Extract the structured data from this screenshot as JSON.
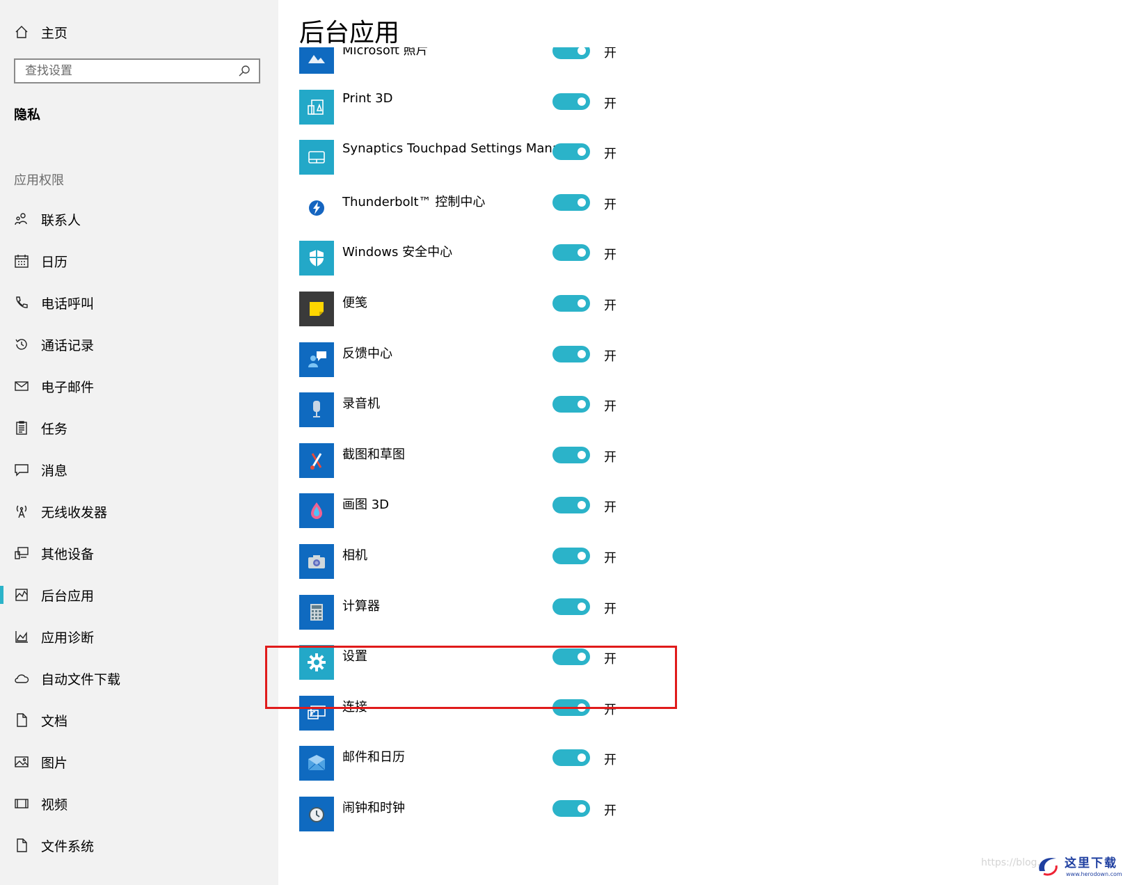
{
  "sidebar": {
    "home_label": "主页",
    "search_placeholder": "查找设置",
    "section_title": "隐私",
    "group_title": "应用权限",
    "items": [
      {
        "label": "联系人",
        "icon": "contacts-icon"
      },
      {
        "label": "日历",
        "icon": "calendar-icon"
      },
      {
        "label": "电话呼叫",
        "icon": "phone-icon"
      },
      {
        "label": "通话记录",
        "icon": "history-icon"
      },
      {
        "label": "电子邮件",
        "icon": "mail-icon"
      },
      {
        "label": "任务",
        "icon": "tasks-icon"
      },
      {
        "label": "消息",
        "icon": "message-icon"
      },
      {
        "label": "无线收发器",
        "icon": "radio-icon"
      },
      {
        "label": "其他设备",
        "icon": "devices-icon"
      },
      {
        "label": "后台应用",
        "icon": "background-apps-icon",
        "active": true
      },
      {
        "label": "应用诊断",
        "icon": "diagnostics-icon"
      },
      {
        "label": "自动文件下载",
        "icon": "cloud-icon"
      },
      {
        "label": "文档",
        "icon": "document-icon"
      },
      {
        "label": "图片",
        "icon": "picture-icon"
      },
      {
        "label": "视频",
        "icon": "video-icon"
      },
      {
        "label": "文件系统",
        "icon": "file-system-icon"
      }
    ]
  },
  "main": {
    "page_title": "后台应用",
    "accent_color": "#2bb3c9",
    "apps": [
      {
        "name": "Microsoft 照片",
        "state": "开",
        "icon": "photos-icon"
      },
      {
        "name": "Print 3D",
        "state": "开",
        "icon": "print3d-icon"
      },
      {
        "name": "Synaptics Touchpad Settings Manag...",
        "state": "开",
        "icon": "touchpad-icon"
      },
      {
        "name": "Thunderbolt™ 控制中心",
        "state": "开",
        "icon": "thunderbolt-icon"
      },
      {
        "name": "Windows 安全中心",
        "state": "开",
        "icon": "security-shield-icon"
      },
      {
        "name": "便笺",
        "state": "开",
        "icon": "sticky-notes-icon"
      },
      {
        "name": "反馈中心",
        "state": "开",
        "icon": "feedback-hub-icon"
      },
      {
        "name": "录音机",
        "state": "开",
        "icon": "voice-recorder-icon"
      },
      {
        "name": "截图和草图",
        "state": "开",
        "icon": "snip-sketch-icon"
      },
      {
        "name": "画图 3D",
        "state": "开",
        "icon": "paint3d-icon"
      },
      {
        "name": "相机",
        "state": "开",
        "icon": "camera-icon"
      },
      {
        "name": "计算器",
        "state": "开",
        "icon": "calculator-icon"
      },
      {
        "name": "设置",
        "state": "开",
        "icon": "settings-gear-icon",
        "highlighted": true
      },
      {
        "name": "连接",
        "state": "开",
        "icon": "connect-icon"
      },
      {
        "name": "邮件和日历",
        "state": "开",
        "icon": "mail-calendar-icon"
      },
      {
        "name": "闹钟和时钟",
        "state": "开",
        "icon": "alarm-clock-icon"
      }
    ]
  },
  "watermark": {
    "url_text": "https://blog.",
    "brand_text": "这里下载",
    "brand_sub": "www.herodown.com"
  }
}
